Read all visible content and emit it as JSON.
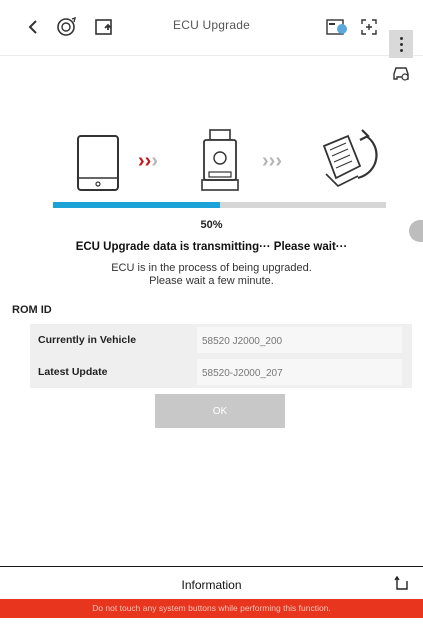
{
  "toolbar": {
    "title": "ECU Upgrade",
    "icons": [
      "back-icon",
      "sync-icon",
      "screen-upload-icon",
      "vci-icon",
      "screenshot-icon",
      "more-icon",
      "car-icon"
    ]
  },
  "progress": {
    "percent_label": "50%",
    "value": 0.5
  },
  "messages": {
    "main": "ECU Upgrade data is transmitting··· Please wait···",
    "sub_line1": "ECU is in the process of being upgraded.",
    "sub_line2": "Please wait a few minute."
  },
  "rom": {
    "label": "ROM ID",
    "rows": [
      {
        "key": "Currently in Vehicle",
        "value": "58520 J2000_200"
      },
      {
        "key": "Latest Update",
        "value": "58520-J2000_207"
      }
    ]
  },
  "ok_label": "OK",
  "info": {
    "title": "Information",
    "warning": "Do not touch any system buttons while performing this function."
  },
  "colors": {
    "progress": "#1ba2d7",
    "warning": "#e8351e",
    "arrow_active": "#c4161c"
  }
}
